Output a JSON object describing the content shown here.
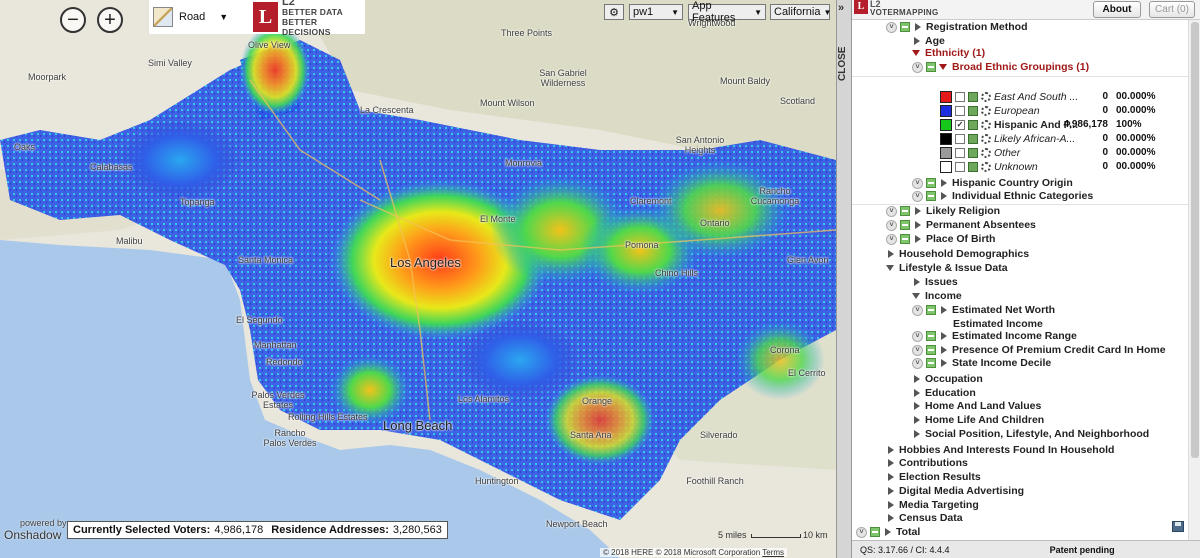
{
  "map": {
    "basemap_label": "Road",
    "logo": {
      "l2": "L2",
      "tagline1": "BETTER DATA",
      "tagline2": "BETTER DECISIONS"
    },
    "controls": {
      "session": "pw1",
      "app_features": "App Features",
      "state": "California"
    },
    "places": [
      {
        "text": "Three Points"
      },
      {
        "text": "Wrightwood"
      },
      {
        "text": "San Gabriel Wilderness"
      },
      {
        "text": "Mount Baldy"
      },
      {
        "text": "Moorpark"
      },
      {
        "text": "Simi Valley"
      },
      {
        "text": "Olive View"
      },
      {
        "text": "La Crescenta"
      },
      {
        "text": "Mount Wilson"
      },
      {
        "text": "Scotland"
      },
      {
        "text": "San Antonio Heights"
      },
      {
        "text": "Oaks"
      },
      {
        "text": "Calabasas"
      },
      {
        "text": "Monrovia"
      },
      {
        "text": "Rancho Cucamonga"
      },
      {
        "text": "Topanga"
      },
      {
        "text": "El Monte"
      },
      {
        "text": "Claremont"
      },
      {
        "text": "Ontario"
      },
      {
        "text": "Malibu"
      },
      {
        "text": "Los Angeles"
      },
      {
        "text": "Pomona"
      },
      {
        "text": "Chino Hills"
      },
      {
        "text": "Glen Avon"
      },
      {
        "text": "Santa Monica"
      },
      {
        "text": "El Segundo"
      },
      {
        "text": "Manhattan"
      },
      {
        "text": "Redondo"
      },
      {
        "text": "Palos Verdes Estates"
      },
      {
        "text": "Rolling Hills Estates"
      },
      {
        "text": "Rancho Palos Verdes"
      },
      {
        "text": "Long Beach"
      },
      {
        "text": "Los Alamitos"
      },
      {
        "text": "Orange"
      },
      {
        "text": "Santa Ana"
      },
      {
        "text": "Silverado"
      },
      {
        "text": "Corona"
      },
      {
        "text": "El Cerrito"
      },
      {
        "text": "Huntington"
      },
      {
        "text": "Foothill Ranch"
      },
      {
        "text": "Newport Beach"
      }
    ],
    "powered_by": "powered by",
    "powered_brand": "Onshadow",
    "status": {
      "voters_label": "Currently Selected Voters:",
      "voters_value": "4,986,178",
      "addresses_label": "Residence Addresses:",
      "addresses_value": "3,280,563"
    },
    "scale": {
      "miles": "5 miles",
      "km": "10 km"
    },
    "attribution": "© 2018 HERE  © 2018 Microsoft Corporation",
    "terms": "Terms"
  },
  "closebar": {
    "label": "CLOSE",
    "arrows": "»"
  },
  "panel": {
    "brand_l2": "L2",
    "brand_vm": "VOTERMAPPING",
    "about": "About",
    "cart": "Cart (0)",
    "tree": {
      "registration_method": "Registration Method",
      "age": "Age",
      "ethnicity": "Ethnicity (1)",
      "broad_groupings": "Broad Ethnic Groupings (1)",
      "ethnic_rows": [
        {
          "label": "East And South ...",
          "count": "0",
          "pct": "00.000%",
          "color": "#e41a1a",
          "checked": false
        },
        {
          "label": "European",
          "count": "0",
          "pct": "00.000%",
          "color": "#1c2fe0",
          "checked": false
        },
        {
          "label": "Hispanic And P...",
          "count": "4,986,178",
          "pct": "100%",
          "color": "#17c81c",
          "checked": true
        },
        {
          "label": "Likely African-A...",
          "count": "0",
          "pct": "00.000%",
          "color": "#000000",
          "checked": false
        },
        {
          "label": "Other",
          "count": "0",
          "pct": "00.000%",
          "color": "#9a9a9a",
          "checked": false
        },
        {
          "label": "Unknown",
          "count": "0",
          "pct": "00.000%",
          "color": "#ffffff",
          "checked": false
        }
      ],
      "hispanic_country": "Hispanic Country Origin",
      "individual_ethnic": "Individual Ethnic Categories",
      "likely_religion": "Likely Religion",
      "permanent_absentees": "Permanent Absentees",
      "place_of_birth": "Place Of Birth",
      "household_demographics": "Household Demographics",
      "lifestyle": "Lifestyle & Issue Data",
      "issues": "Issues",
      "income": "Income",
      "net_worth": "Estimated Net Worth",
      "est_income": "Estimated Income",
      "est_income_range": "Estimated Income Range",
      "premium_cc": "Presence Of Premium Credit Card In Home",
      "state_income_decile": "State Income Decile",
      "occupation": "Occupation",
      "education": "Education",
      "home_land": "Home And Land Values",
      "home_life": "Home Life And Children",
      "social_position": "Social Position, Lifestyle, And Neighborhood",
      "hobbies": "Hobbies And Interests Found In Household",
      "contributions": "Contributions",
      "election_results": "Election Results",
      "digital_media": "Digital Media Advertising",
      "media_targeting": "Media Targeting",
      "census_data": "Census Data",
      "total": "Total"
    },
    "footer": {
      "version": "QS: 3.17.66 / CI: 4.4.4",
      "patent": "Patent pending"
    }
  },
  "colors": {
    "brand_red": "#b41f2b",
    "expanded_red": "#a01818",
    "water": "#a9c8ea",
    "land": "#e9e6dc"
  }
}
